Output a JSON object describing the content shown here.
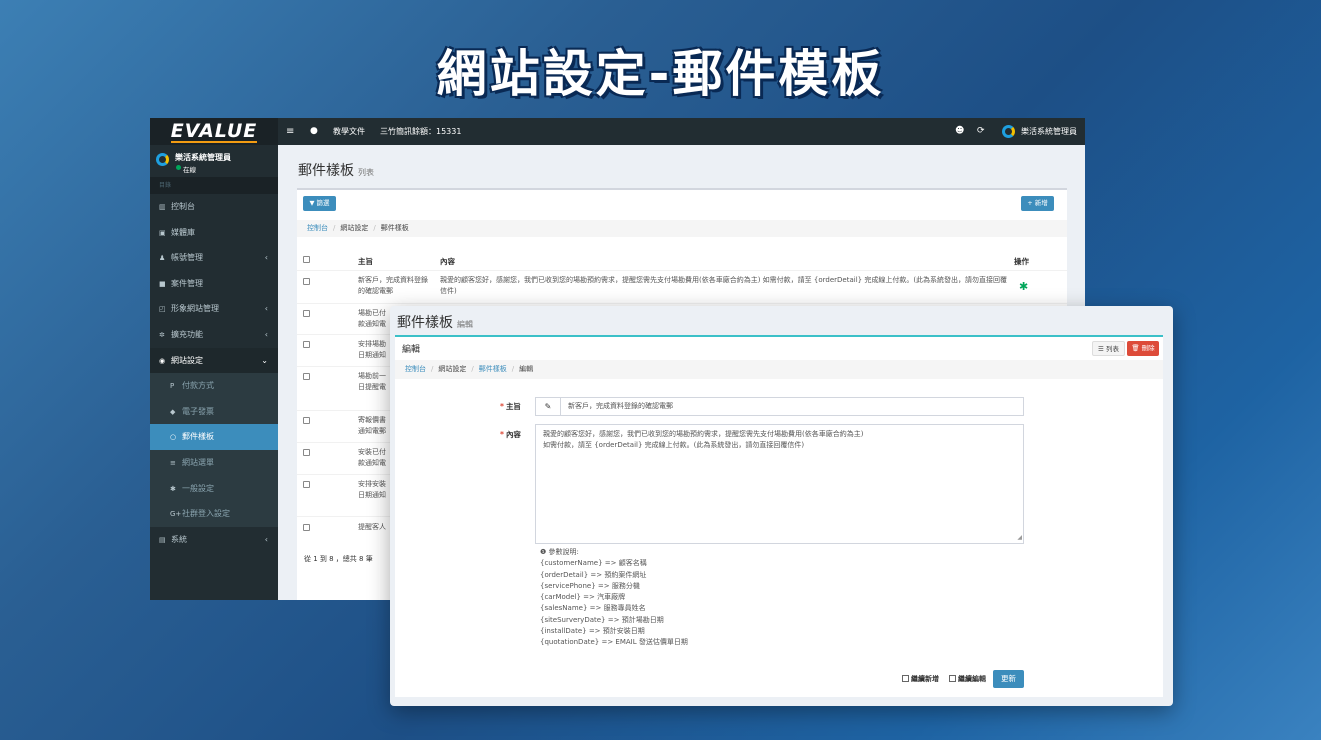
{
  "banner": {
    "title": "網站設定-郵件模板"
  },
  "back": {
    "logo": "EVALUE",
    "topbar": {
      "menu_icon": "bars-icon",
      "globe_icon": "globe-icon",
      "docs": "教學文件",
      "sms": "三竹簡訊餘額：15331",
      "user": "樂活系統管理員"
    },
    "sidebar": {
      "user_name": "樂活系統管理員",
      "status": "在線",
      "section": "目錄",
      "items": [
        {
          "label": "控制台",
          "icon": "▥"
        },
        {
          "label": "媒體庫",
          "icon": "▣"
        },
        {
          "label": "帳號管理",
          "icon": "♟"
        },
        {
          "label": "案件管理",
          "icon": "■"
        },
        {
          "label": "形象網站管理",
          "icon": "◰"
        },
        {
          "label": "擴充功能",
          "icon": "✲"
        },
        {
          "label": "網站設定",
          "icon": "◉"
        }
      ],
      "sub": [
        {
          "label": "付款方式",
          "icon": "P"
        },
        {
          "label": "電子發票",
          "icon": "◆"
        },
        {
          "label": "郵件樣板",
          "icon": "○"
        },
        {
          "label": "網站選單",
          "icon": "≡"
        },
        {
          "label": "一般設定",
          "icon": "✱"
        },
        {
          "label": "社群登入設定",
          "icon": "G+"
        }
      ],
      "system": "系統"
    },
    "page_title": "郵件樣板",
    "page_subtitle": "列表",
    "filter_btn": "▼ 篩選",
    "add_btn": "+ 新增",
    "breadcrumb": [
      "控制台",
      "網站設定",
      "郵件樣板"
    ],
    "table": {
      "headers": [
        "主旨",
        "內容",
        "操作"
      ],
      "rows": [
        {
          "subject": "新客戶，完成資料登錄的確認電郵",
          "content": "親愛的顧客您好，感謝您，我們已收到您的場勘預約需求，提醒您需先支付場勘費用(依各車廠合約為主) 如需付款，請至 {orderDetail} 完成線上付款。(此為系統發出，請勿直接回覆信件)"
        },
        {
          "subject": "場勘已付款通知電郵",
          "content": ""
        },
        {
          "subject": "安排場勘日期通知電郵",
          "content": ""
        },
        {
          "subject": "場勘前一日提醒電郵",
          "content": ""
        },
        {
          "subject": "寄報價書通知電郵",
          "content": ""
        },
        {
          "subject": "安裝已付款通知電郵",
          "content": ""
        },
        {
          "subject": "安排安裝日期通知電郵",
          "content": ""
        },
        {
          "subject": "提醒客人回覆",
          "content": ""
        }
      ]
    },
    "footer": "從 1 到 8 ，總共 8 筆"
  },
  "front": {
    "page_title": "郵件樣板",
    "page_subtitle": "編輯",
    "box_title": "編輯",
    "list_btn": "☰ 列表",
    "delete_btn": "🗑 刪除",
    "breadcrumb": [
      "控制台",
      "網站設定",
      "郵件樣板",
      "編輯"
    ],
    "subject_label": "主旨",
    "subject_value": "新客戶，完成資料登錄的確認電郵",
    "content_label": "內容",
    "content_line1": "親愛的顧客您好，感謝您，我們已收到您的場勘預約需求，提醒您需先支付場勘費用(依各車廠合約為主)",
    "content_line2": "如需付款，請至 {orderDetail} 完成線上付款。(此為系統發出，請勿直接回覆信件)",
    "help_title": "參數說明:",
    "params": [
      "{customerName} => 顧客名稱",
      "{orderDetail} => 預約案件網址",
      "{servicePhone} => 服務分機",
      "{carModel} => 汽車廠牌",
      "{salesName} => 服務專員姓名",
      "{siteSurveryDate} => 預計場勘日期",
      "{installDate} => 預計安裝日期",
      "{quotationDate} => EMAIL 發送估價單日期"
    ],
    "continue_add": "繼續新增",
    "continue_edit": "繼續編輯",
    "update_btn": "更新"
  }
}
